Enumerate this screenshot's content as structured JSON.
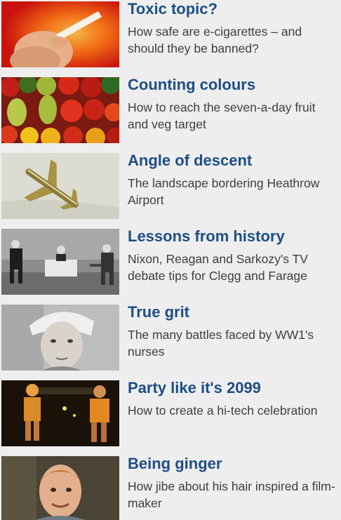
{
  "items": [
    {
      "title": "Toxic topic?",
      "summary": "How safe are e-cigarettes – and should they be banned?",
      "thumbnail": "cigarette-photo"
    },
    {
      "title": "Counting colours",
      "summary": "How to reach the seven-a-day fruit and veg target",
      "thumbnail": "vegetables-photo"
    },
    {
      "title": "Angle of descent",
      "summary": "The landscape bordering Heathrow Airport",
      "thumbnail": "aircraft-photo"
    },
    {
      "title": "Lessons from history",
      "summary": "Nixon, Reagan and Sarkozy's TV debate tips for Clegg and Farage",
      "thumbnail": "tv-debate-photo"
    },
    {
      "title": "True grit",
      "summary": "The many battles faced by WW1's nurses",
      "thumbnail": "nurse-portrait-photo"
    },
    {
      "title": "Party like it's 2099",
      "summary": "How to create a hi-tech celebration",
      "thumbnail": "party-photo"
    },
    {
      "title": "Being ginger",
      "summary": "How jibe about his hair inspired a film-maker",
      "thumbnail": "ginger-man-photo"
    }
  ]
}
